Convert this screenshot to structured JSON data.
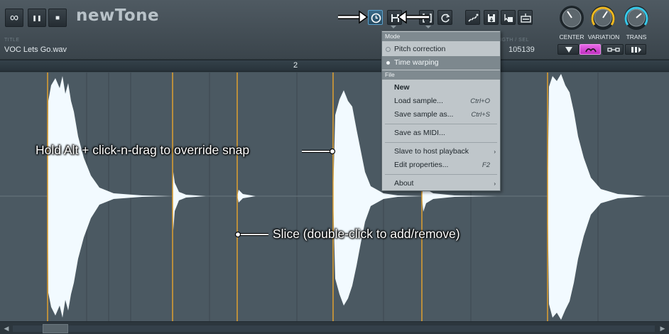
{
  "app": {
    "logo": "newTone",
    "title_label": "TITLE",
    "title_value": "VOC Lets Go.wav",
    "length_label": "NGTH / SEL",
    "length_value": "105139"
  },
  "transport": {
    "loop_icon": "infinity-icon",
    "loop_glyph": "∞",
    "pause_glyph": "❚❚",
    "stop_glyph": "■"
  },
  "knobs": [
    {
      "label": "CENTER",
      "color": "#c8d0d4"
    },
    {
      "label": "VARIATION",
      "color": "#f0b820"
    },
    {
      "label": "TRANS",
      "color": "#38c8e8"
    }
  ],
  "ruler": {
    "bar_number": "2"
  },
  "menu": {
    "mode_header": "Mode",
    "pitch_correction": "Pitch correction",
    "time_warping": "Time warping",
    "file_header": "File",
    "new": "New",
    "load_sample": "Load sample...",
    "load_shortcut": "Ctrl+O",
    "save_sample": "Save sample as...",
    "save_shortcut": "Ctrl+S",
    "save_midi": "Save as MIDI...",
    "slave": "Slave to host playback",
    "edit_properties": "Edit properties...",
    "edit_shortcut": "F2",
    "about": "About"
  },
  "annotations": {
    "snap": "Hold Alt + click-n-drag to override snap",
    "slice": "Slice (double-click to add/remove)"
  },
  "colors": {
    "slice_line": "#e0a030",
    "waveform": "#f4fbff",
    "accent_pink": "#e040e0"
  }
}
